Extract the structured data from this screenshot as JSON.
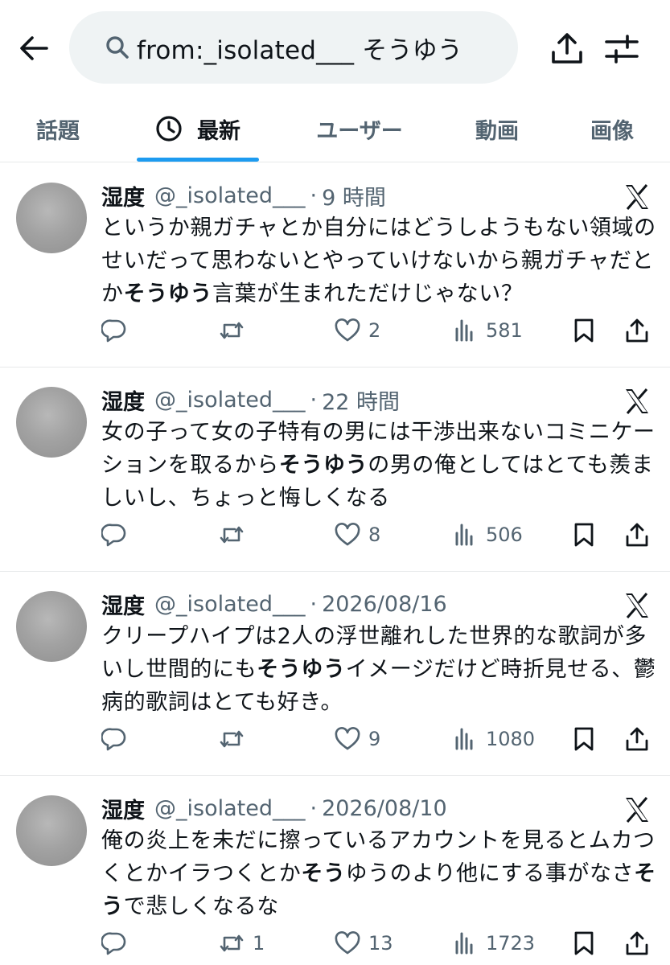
{
  "search": {
    "query": "from:_isolated___ そうゆう"
  },
  "tabs": [
    {
      "label": "話題"
    },
    {
      "label": "最新"
    },
    {
      "label": "ユーザー"
    },
    {
      "label": "動画"
    },
    {
      "label": "画像"
    }
  ],
  "tweets": [
    {
      "name": "湿度",
      "handle": "@_isolated___",
      "time": "9 時間",
      "text_before": "というか親ガチャとか自分にはどうしようもない領域のせいだって思わないとやっていけないから親ガチャだとか",
      "text_bold": "そうゆう",
      "text_after": "言葉が生まれただけじゃない？",
      "replies": "",
      "retweets": "",
      "likes": "2",
      "views": "581"
    },
    {
      "name": "湿度",
      "handle": "@_isolated___",
      "time": "22 時間",
      "text_before": "女の子って女の子特有の男には干渉出来ないコミニケーションを取るから",
      "text_bold": "そうゆう",
      "text_after": "の男の俺としてはとても羨ましいし、ちょっと悔しくなる",
      "replies": "",
      "retweets": "",
      "likes": "8",
      "views": "506"
    },
    {
      "name": "湿度",
      "handle": "@_isolated___",
      "time": "2026/08/16",
      "text_before": "クリープハイプは2人の浮世離れした世界的な歌詞が多いし世間的にも",
      "text_bold": "そうゆう",
      "text_after": "イメージだけど時折見せる、鬱病的歌詞はとても好き。",
      "replies": "",
      "retweets": "",
      "likes": "9",
      "views": "1080"
    },
    {
      "name": "湿度",
      "handle": "@_isolated___",
      "time": "2026/08/10",
      "text_before": "俺の炎上を未だに擦っているアカウントを見るとムカつくとかイラつくとか",
      "text_bold": "そう",
      "text_mid": "ゆうのより他にする事がなさ",
      "text_bold2": "そう",
      "text_after": "で悲しくなるな",
      "replies": "",
      "retweets": "1",
      "likes": "13",
      "views": "1723"
    }
  ],
  "colors": {
    "text": "#0f1419",
    "secondary": "#536471",
    "search_bg": "#eff3f4",
    "accent": "#1d9bf0",
    "divider": "#e7e9ea"
  },
  "icons": [
    "back-arrow-icon",
    "search-icon",
    "share-icon",
    "filter-icon",
    "clock-icon",
    "x-logo-icon",
    "reply-icon",
    "retweet-icon",
    "like-icon",
    "views-icon",
    "bookmark-icon",
    "share-post-icon"
  ]
}
